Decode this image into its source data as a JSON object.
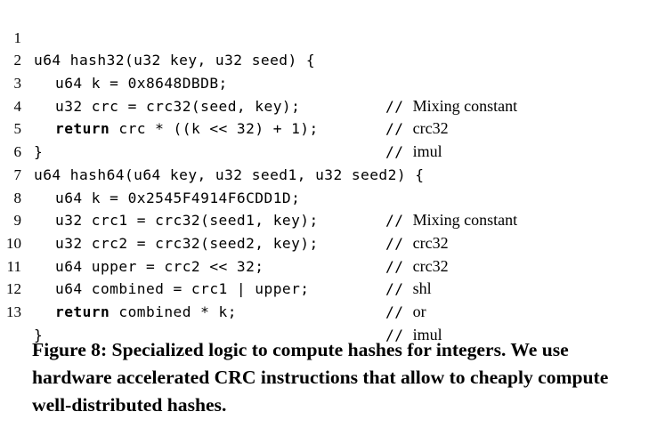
{
  "listing": {
    "lines": [
      {
        "num": "1",
        "indent": 0,
        "keyword": "",
        "code": "u64 hash32(u32 key, u32 seed) {",
        "comment": "",
        "comment_text": ""
      },
      {
        "num": "2",
        "indent": 1,
        "keyword": "",
        "code": "u64 k = 0x8648DBDB;",
        "comment": "//",
        "comment_text": "Mixing constant"
      },
      {
        "num": "3",
        "indent": 1,
        "keyword": "",
        "code": "u32 crc = crc32(seed, key);",
        "comment": "//",
        "comment_text": "crc32"
      },
      {
        "num": "4",
        "indent": 1,
        "keyword": "return",
        "code": " crc * ((k << 32) + 1);",
        "comment": "//",
        "comment_text": "imul"
      },
      {
        "num": "5",
        "indent": 0,
        "keyword": "",
        "code": "}",
        "comment": "",
        "comment_text": ""
      },
      {
        "num": "6",
        "indent": 0,
        "keyword": "",
        "code": "u64 hash64(u64 key, u32 seed1, u32 seed2) {",
        "comment": "",
        "comment_text": ""
      },
      {
        "num": "7",
        "indent": 1,
        "keyword": "",
        "code": "u64 k = 0x2545F4914F6CDD1D;",
        "comment": "//",
        "comment_text": "Mixing constant"
      },
      {
        "num": "8",
        "indent": 1,
        "keyword": "",
        "code": "u32 crc1 = crc32(seed1, key);",
        "comment": "//",
        "comment_text": "crc32"
      },
      {
        "num": "9",
        "indent": 1,
        "keyword": "",
        "code": "u32 crc2 = crc32(seed2, key);",
        "comment": "//",
        "comment_text": "crc32"
      },
      {
        "num": "10",
        "indent": 1,
        "keyword": "",
        "code": "u64 upper = crc2 << 32;",
        "comment": "//",
        "comment_text": "shl"
      },
      {
        "num": "11",
        "indent": 1,
        "keyword": "",
        "code": "u64 combined = crc1 | upper;",
        "comment": "//",
        "comment_text": "or"
      },
      {
        "num": "12",
        "indent": 1,
        "keyword": "return",
        "code": " combined * k;",
        "comment": "//",
        "comment_text": "imul"
      },
      {
        "num": "13",
        "indent": 0,
        "keyword": "",
        "code": "}",
        "comment": "",
        "comment_text": ""
      }
    ]
  },
  "caption": {
    "text": "Figure 8: Specialized logic to compute hashes for integers. We use hardware accelerated CRC instructions that allow to cheaply compute well-distributed hashes."
  }
}
